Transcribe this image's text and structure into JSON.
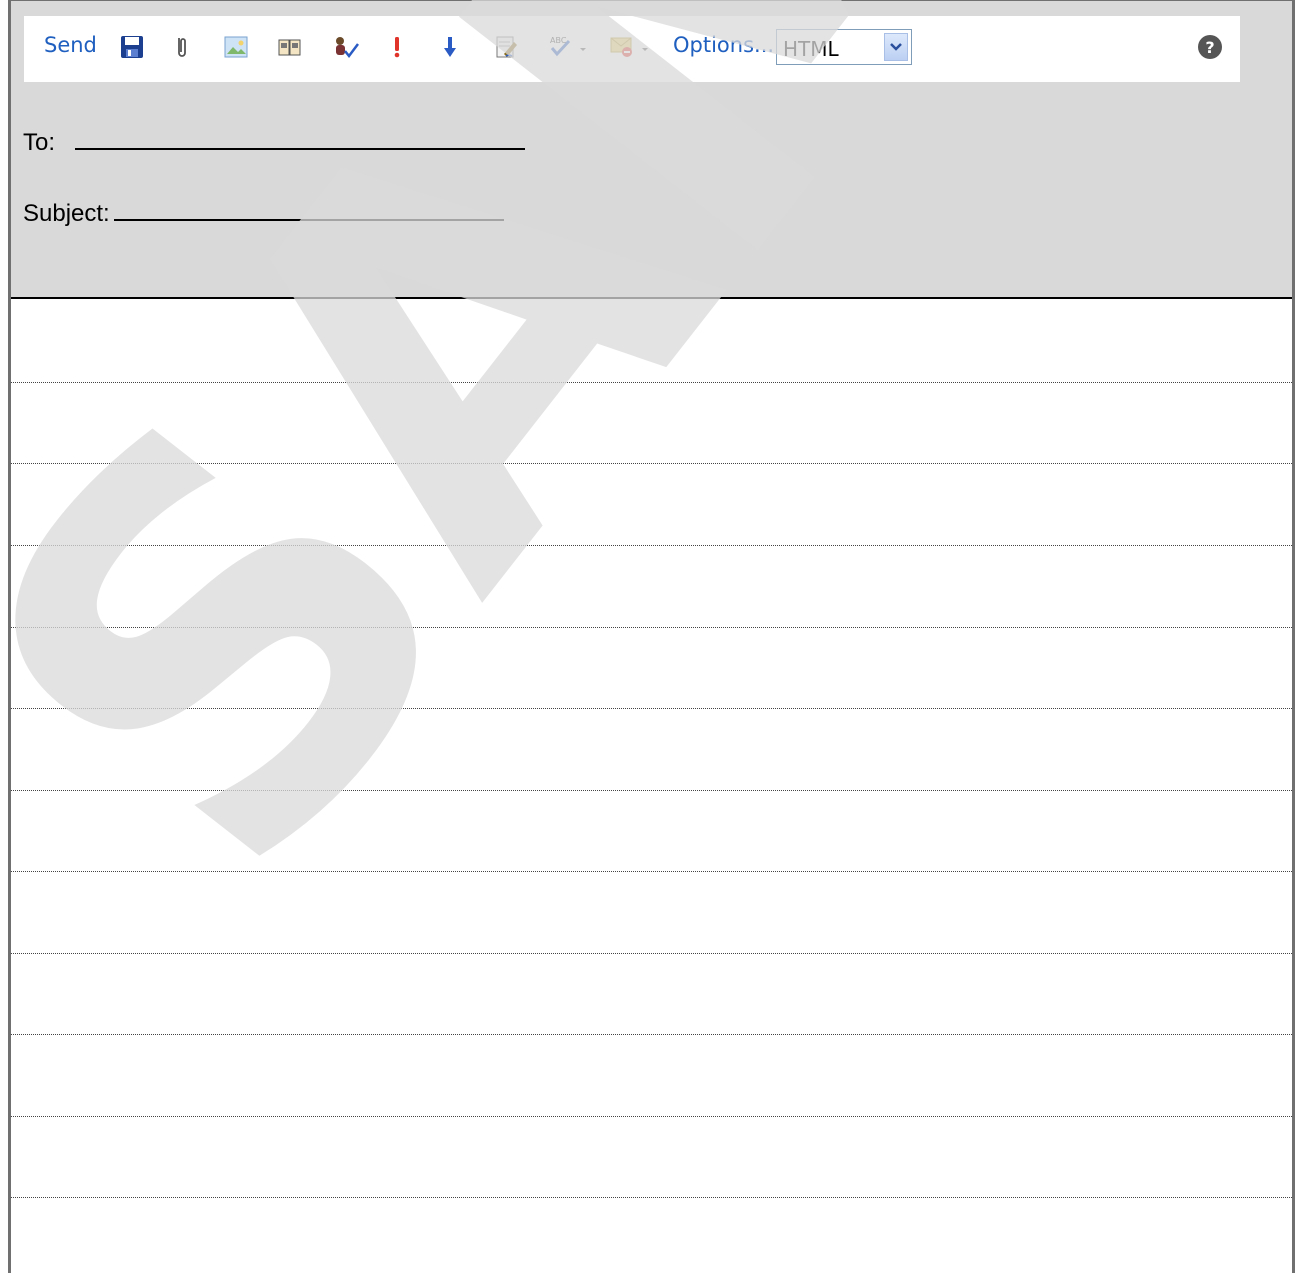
{
  "toolbar": {
    "send_label": "Send",
    "options_label": "Options...",
    "format_select_value": "HTML",
    "icons": [
      "save-icon",
      "attach-icon",
      "insert-image-icon",
      "address-book-icon",
      "check-names-icon",
      "high-importance-icon",
      "low-importance-icon",
      "signature-icon",
      "spelling-icon",
      "permission-icon",
      "help-icon"
    ]
  },
  "header": {
    "to_label": "To:",
    "subject_label": "Subject:"
  },
  "colors": {
    "header_bg": "#d9d9d9",
    "toolbar_text": "#1f5fbf",
    "watermark": "#d9d9d9"
  },
  "watermark_text": "SAMPLE"
}
